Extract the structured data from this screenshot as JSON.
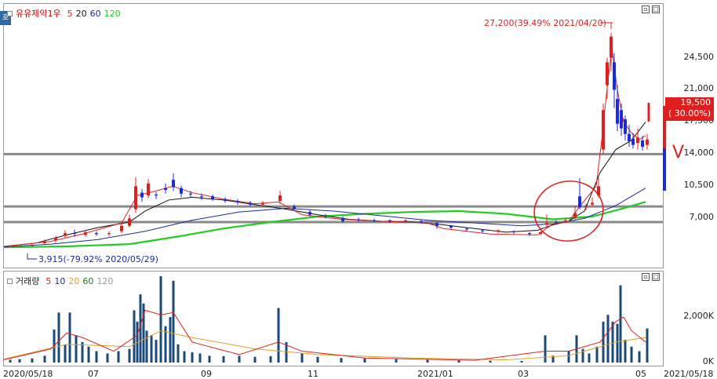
{
  "price_legend": {
    "stock_name": "유유제약1우",
    "ma_labels": [
      "5",
      "20",
      "60",
      "120"
    ],
    "ma_colors": [
      "#e02020",
      "#111111",
      "#1b2a9c",
      "#22cc22"
    ]
  },
  "volume_legend": {
    "title": "거래량",
    "ma_labels": [
      "5",
      "10",
      "20",
      "60",
      "120"
    ],
    "ma_colors": [
      "#e02020",
      "#1b2a9c",
      "#e0a020",
      "#1a7a1a",
      "#999999"
    ]
  },
  "side_tab": "호",
  "annotations": {
    "high": "27,200(39.49% 2021/04/20)",
    "low": "3,915(-79.92% 2020/05/29)",
    "current_price": "19,500",
    "current_change": "( 30.00%)",
    "check_mark": "V"
  },
  "price_axis": [
    "24,500",
    "21,000",
    "17,500",
    "14,000",
    "10,500",
    "7,000"
  ],
  "volume_axis": [
    "2,000K",
    "0K"
  ],
  "x_axis": [
    "2020/05/18",
    "07",
    "09",
    "11",
    "2021/01",
    "03",
    "05"
  ],
  "last_date": "2021/05/18",
  "chart_data": {
    "type": "candlestick",
    "title": "유유제약1우",
    "ylim": [
      2500,
      29500
    ],
    "price_ticks": [
      7000,
      10500,
      14000,
      17500,
      21000,
      24500
    ],
    "horizontal_lines": [
      14000,
      8300,
      6600
    ],
    "ma20_series": [
      [
        0,
        3950
      ],
      [
        40,
        4300
      ],
      [
        80,
        5200
      ],
      [
        120,
        6000
      ],
      [
        160,
        6600
      ],
      [
        180,
        7800
      ],
      [
        210,
        9000
      ],
      [
        240,
        9300
      ],
      [
        280,
        9000
      ],
      [
        320,
        8500
      ],
      [
        360,
        8000
      ],
      [
        400,
        7400
      ],
      [
        440,
        6900
      ],
      [
        480,
        6700
      ],
      [
        520,
        6600
      ],
      [
        560,
        6300
      ],
      [
        600,
        5900
      ],
      [
        640,
        5500
      ],
      [
        680,
        5700
      ],
      [
        700,
        6300
      ],
      [
        720,
        6700
      ],
      [
        740,
        7800
      ],
      [
        760,
        12000
      ],
      [
        780,
        14500
      ],
      [
        800,
        15500
      ],
      [
        818,
        17500
      ]
    ],
    "ma60_series": [
      [
        0,
        3900
      ],
      [
        60,
        4200
      ],
      [
        120,
        4700
      ],
      [
        180,
        5600
      ],
      [
        240,
        6800
      ],
      [
        300,
        7700
      ],
      [
        360,
        8100
      ],
      [
        420,
        7800
      ],
      [
        480,
        7300
      ],
      [
        540,
        6800
      ],
      [
        600,
        6500
      ],
      [
        660,
        6200
      ],
      [
        700,
        6400
      ],
      [
        740,
        7000
      ],
      [
        780,
        8400
      ],
      [
        818,
        10300
      ]
    ],
    "ma120_series": [
      [
        0,
        3850
      ],
      [
        80,
        3950
      ],
      [
        160,
        4200
      ],
      [
        220,
        5000
      ],
      [
        280,
        5900
      ],
      [
        340,
        6600
      ],
      [
        400,
        7200
      ],
      [
        460,
        7500
      ],
      [
        520,
        7700
      ],
      [
        580,
        7800
      ],
      [
        640,
        7500
      ],
      [
        700,
        6900
      ],
      [
        750,
        7200
      ],
      [
        790,
        8100
      ],
      [
        818,
        8800
      ]
    ],
    "ma5_series": [
      [
        0,
        3950
      ],
      [
        60,
        4500
      ],
      [
        100,
        5300
      ],
      [
        150,
        6500
      ],
      [
        170,
        9500
      ],
      [
        190,
        9900
      ],
      [
        215,
        10500
      ],
      [
        240,
        9800
      ],
      [
        280,
        9100
      ],
      [
        320,
        8600
      ],
      [
        350,
        8800
      ],
      [
        380,
        7400
      ],
      [
        430,
        6900
      ],
      [
        480,
        6700
      ],
      [
        540,
        6500
      ],
      [
        560,
        5900
      ],
      [
        620,
        5300
      ],
      [
        680,
        5200
      ],
      [
        700,
        6400
      ],
      [
        720,
        6700
      ],
      [
        735,
        8400
      ],
      [
        755,
        10500
      ],
      [
        762,
        15500
      ],
      [
        770,
        22000
      ],
      [
        775,
        25500
      ],
      [
        782,
        21000
      ],
      [
        790,
        17500
      ],
      [
        800,
        16300
      ],
      [
        810,
        15600
      ],
      [
        818,
        16000
      ]
    ],
    "candles": [
      [
        8,
        3950,
        4000,
        3900,
        4050
      ],
      [
        20,
        3960,
        4000,
        3915,
        4050
      ],
      [
        36,
        4000,
        4100,
        3950,
        4200
      ],
      [
        52,
        4300,
        4500,
        4200,
        4700
      ],
      [
        66,
        4600,
        4900,
        4400,
        5100
      ],
      [
        78,
        5100,
        5400,
        4900,
        5700
      ],
      [
        90,
        5400,
        5300,
        5000,
        5800
      ],
      [
        104,
        5200,
        5500,
        5000,
        5700
      ],
      [
        118,
        5400,
        5300,
        5100,
        5600
      ],
      [
        134,
        5300,
        5400,
        5100,
        5600
      ],
      [
        150,
        5600,
        6200,
        5400,
        6600
      ],
      [
        160,
        6200,
        7000,
        6000,
        7400
      ],
      [
        168,
        8000,
        10500,
        7600,
        11500
      ],
      [
        176,
        9800,
        9300,
        8800,
        10200
      ],
      [
        184,
        9500,
        10800,
        9200,
        11300
      ],
      [
        194,
        9600,
        9500,
        9100,
        9900
      ],
      [
        206,
        10300,
        10100,
        9700,
        10800
      ],
      [
        216,
        11200,
        10400,
        10000,
        11900
      ],
      [
        226,
        10300,
        9700,
        9300,
        10600
      ],
      [
        238,
        9700,
        9600,
        9300,
        10000
      ],
      [
        252,
        9400,
        9300,
        9000,
        9700
      ],
      [
        266,
        9400,
        9100,
        8900,
        9600
      ],
      [
        282,
        9100,
        8900,
        8700,
        9300
      ],
      [
        298,
        8900,
        8800,
        8500,
        9100
      ],
      [
        314,
        8700,
        8500,
        8300,
        8900
      ],
      [
        330,
        8500,
        8700,
        8300,
        8900
      ],
      [
        352,
        8900,
        9500,
        8600,
        10000
      ],
      [
        370,
        8300,
        8000,
        7800,
        8500
      ],
      [
        390,
        7700,
        7400,
        7200,
        7900
      ],
      [
        410,
        7300,
        7200,
        7000,
        7500
      ],
      [
        432,
        7000,
        6700,
        6500,
        7200
      ],
      [
        452,
        6900,
        6800,
        6600,
        7100
      ],
      [
        472,
        6800,
        6700,
        6600,
        7000
      ],
      [
        492,
        6800,
        6700,
        6500,
        6900
      ],
      [
        512,
        6700,
        6800,
        6600,
        6900
      ],
      [
        532,
        6700,
        6600,
        6400,
        6800
      ],
      [
        552,
        6500,
        6200,
        5900,
        6600
      ],
      [
        570,
        6200,
        6000,
        5800,
        6300
      ],
      [
        590,
        5900,
        5800,
        5600,
        6000
      ],
      [
        610,
        5700,
        5600,
        5400,
        5800
      ],
      [
        630,
        5600,
        5700,
        5400,
        5800
      ],
      [
        650,
        5600,
        5500,
        5300,
        5700
      ],
      [
        670,
        5400,
        5300,
        5100,
        5500
      ],
      [
        684,
        5300,
        5500,
        5200,
        5600
      ],
      [
        692,
        6300,
        6500,
        6000,
        7400
      ],
      [
        704,
        6600,
        6500,
        6300,
        6800
      ],
      [
        716,
        6700,
        6800,
        6500,
        7000
      ],
      [
        728,
        7100,
        7600,
        6900,
        8400
      ],
      [
        734,
        9400,
        8200,
        8000,
        11400
      ],
      [
        742,
        8200,
        8300,
        7900,
        8600
      ],
      [
        750,
        8500,
        8700,
        8300,
        9300
      ],
      [
        758,
        9500,
        10500,
        9300,
        11400
      ],
      [
        764,
        14500,
        18800,
        14000,
        19500
      ],
      [
        769,
        21500,
        24000,
        20000,
        24500
      ],
      [
        774,
        24500,
        26800,
        23000,
        27200
      ],
      [
        778,
        24000,
        21000,
        19000,
        25000
      ],
      [
        782,
        20000,
        17300,
        16500,
        21500
      ],
      [
        787,
        18800,
        16800,
        16000,
        19500
      ],
      [
        792,
        17800,
        16200,
        15500,
        18200
      ],
      [
        797,
        16200,
        15400,
        14800,
        17200
      ],
      [
        802,
        15700,
        15000,
        14600,
        16300
      ],
      [
        808,
        15200,
        15800,
        14500,
        16800
      ],
      [
        814,
        15500,
        14800,
        14400,
        16000
      ],
      [
        820,
        15000,
        15600,
        14500,
        16200
      ]
    ],
    "volume_ylim": [
      0,
      3800
    ],
    "volume_bars": [
      [
        8,
        120
      ],
      [
        20,
        150
      ],
      [
        36,
        180
      ],
      [
        52,
        300
      ],
      [
        64,
        1450
      ],
      [
        70,
        2200
      ],
      [
        78,
        800
      ],
      [
        84,
        2200
      ],
      [
        92,
        1200
      ],
      [
        100,
        900
      ],
      [
        108,
        700
      ],
      [
        118,
        500
      ],
      [
        132,
        400
      ],
      [
        146,
        500
      ],
      [
        160,
        600
      ],
      [
        166,
        2300
      ],
      [
        170,
        1800
      ],
      [
        174,
        3000
      ],
      [
        178,
        2600
      ],
      [
        182,
        1400
      ],
      [
        188,
        1200
      ],
      [
        194,
        1000
      ],
      [
        200,
        3800
      ],
      [
        206,
        1600
      ],
      [
        212,
        2000
      ],
      [
        216,
        3600
      ],
      [
        222,
        800
      ],
      [
        230,
        500
      ],
      [
        240,
        450
      ],
      [
        250,
        400
      ],
      [
        262,
        300
      ],
      [
        280,
        280
      ],
      [
        300,
        300
      ],
      [
        320,
        250
      ],
      [
        340,
        280
      ],
      [
        350,
        2400
      ],
      [
        360,
        900
      ],
      [
        380,
        400
      ],
      [
        400,
        250
      ],
      [
        430,
        200
      ],
      [
        460,
        180
      ],
      [
        500,
        150
      ],
      [
        540,
        120
      ],
      [
        580,
        100
      ],
      [
        620,
        80
      ],
      [
        660,
        70
      ],
      [
        690,
        1200
      ],
      [
        700,
        300
      ],
      [
        720,
        500
      ],
      [
        730,
        1200
      ],
      [
        738,
        600
      ],
      [
        746,
        400
      ],
      [
        756,
        700
      ],
      [
        764,
        1800
      ],
      [
        770,
        2100
      ],
      [
        776,
        1800
      ],
      [
        782,
        1700
      ],
      [
        786,
        3400
      ],
      [
        792,
        1000
      ],
      [
        800,
        700
      ],
      [
        810,
        500
      ],
      [
        820,
        1500
      ]
    ],
    "volume_ma5": [
      [
        0,
        120
      ],
      [
        60,
        600
      ],
      [
        80,
        1300
      ],
      [
        100,
        1100
      ],
      [
        140,
        500
      ],
      [
        170,
        1200
      ],
      [
        180,
        2300
      ],
      [
        200,
        2100
      ],
      [
        216,
        2200
      ],
      [
        240,
        900
      ],
      [
        300,
        350
      ],
      [
        350,
        900
      ],
      [
        380,
        500
      ],
      [
        460,
        200
      ],
      [
        600,
        100
      ],
      [
        690,
        500
      ],
      [
        720,
        500
      ],
      [
        760,
        900
      ],
      [
        780,
        1800
      ],
      [
        790,
        2000
      ],
      [
        800,
        1400
      ],
      [
        818,
        900
      ]
    ],
    "volume_ma20": [
      [
        0,
        150
      ],
      [
        80,
        800
      ],
      [
        160,
        700
      ],
      [
        200,
        1400
      ],
      [
        240,
        1100
      ],
      [
        320,
        600
      ],
      [
        400,
        350
      ],
      [
        520,
        200
      ],
      [
        640,
        120
      ],
      [
        720,
        300
      ],
      [
        780,
        900
      ],
      [
        818,
        1100
      ]
    ]
  }
}
